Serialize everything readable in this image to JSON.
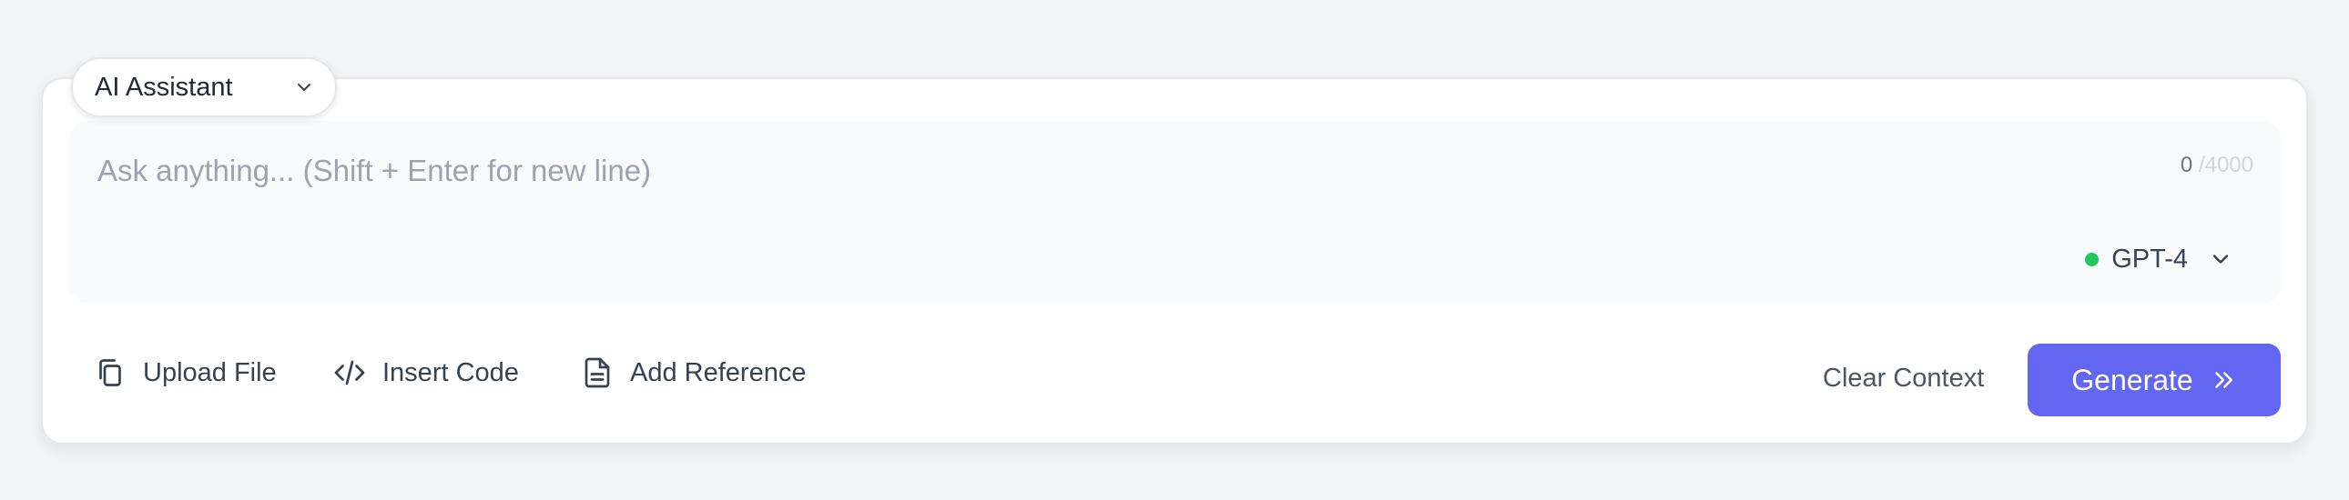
{
  "assistant_selector": {
    "label": "AI Assistant",
    "icon": "chevron-down-icon"
  },
  "prompt": {
    "value": "",
    "placeholder": "Ask anything... (Shift + Enter for new line)",
    "char_count": "0",
    "char_max": "/4000"
  },
  "model_selector": {
    "label": "GPT-4",
    "status_color": "#22c55e",
    "icon": "chevron-down-icon"
  },
  "toolbar": {
    "upload_label": "Upload File",
    "upload_icon": "copy-icon",
    "code_label": "Insert Code",
    "code_icon": "code-icon",
    "reference_label": "Add Reference",
    "reference_icon": "document-icon"
  },
  "actions": {
    "clear_label": "Clear Context",
    "generate_label": "Generate",
    "generate_icon": "chevrons-right-icon"
  },
  "colors": {
    "accent": "#6366f1",
    "background": "#f3f4f6",
    "card": "#ffffff",
    "input_area": "#f9fafb"
  }
}
